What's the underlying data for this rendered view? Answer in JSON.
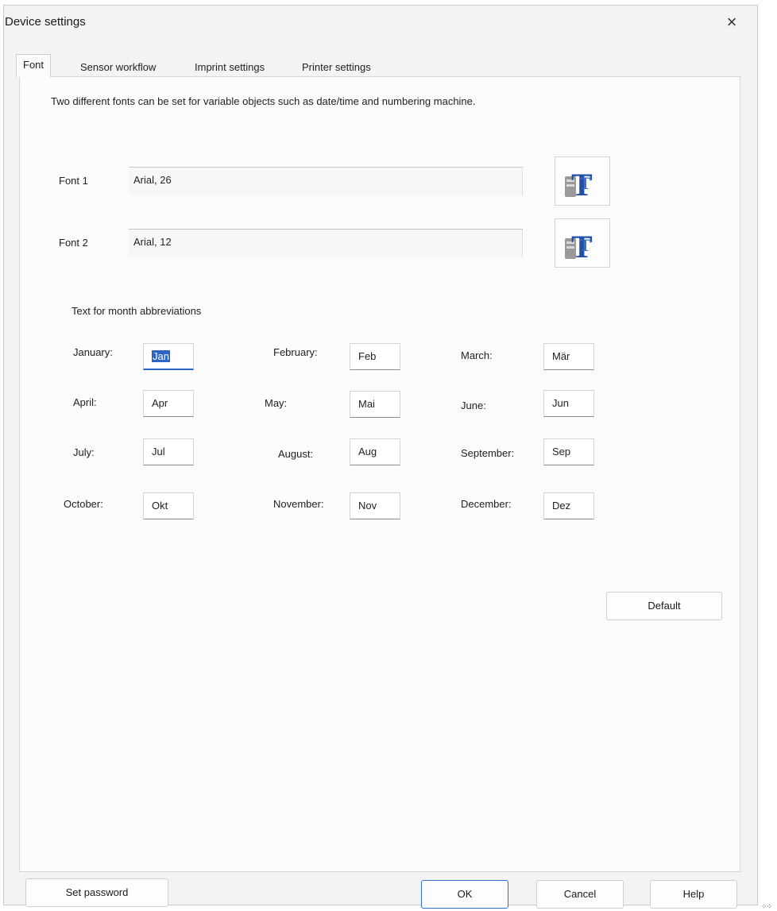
{
  "window": {
    "title": "Device settings",
    "close_symbol": "×"
  },
  "tabs": [
    {
      "label": "Font",
      "active": true
    },
    {
      "label": "Sensor workflow",
      "active": false
    },
    {
      "label": "Imprint settings",
      "active": false
    },
    {
      "label": "Printer settings",
      "active": false
    }
  ],
  "font_tab": {
    "description": "Two different fonts can be set for variable objects such as date/time and numbering machine.",
    "font1": {
      "label": "Font 1",
      "value": "Arial, 26"
    },
    "font2": {
      "label": "Font 2",
      "value": "Arial, 12"
    },
    "font_button_icon": "font-dialog-icon",
    "months_section_label": "Text for month abbreviations",
    "months": [
      {
        "label": "January:",
        "value": "Jan",
        "focused": true
      },
      {
        "label": "February:",
        "value": "Feb"
      },
      {
        "label": "March:",
        "value": "Mär"
      },
      {
        "label": "April:",
        "value": "Apr"
      },
      {
        "label": "May:",
        "value": "Mai"
      },
      {
        "label": "June:",
        "value": "Jun"
      },
      {
        "label": "July:",
        "value": "Jul"
      },
      {
        "label": "August:",
        "value": "Aug"
      },
      {
        "label": "September:",
        "value": "Sep"
      },
      {
        "label": "October:",
        "value": "Okt"
      },
      {
        "label": "November:",
        "value": "Nov"
      },
      {
        "label": "December:",
        "value": "Dez"
      }
    ],
    "default_button": "Default"
  },
  "footer": {
    "set_password": "Set password",
    "ok": "OK",
    "cancel": "Cancel",
    "help": "Help"
  },
  "colors": {
    "accent": "#2b66c7",
    "icon_blue": "#1f4fa8"
  }
}
